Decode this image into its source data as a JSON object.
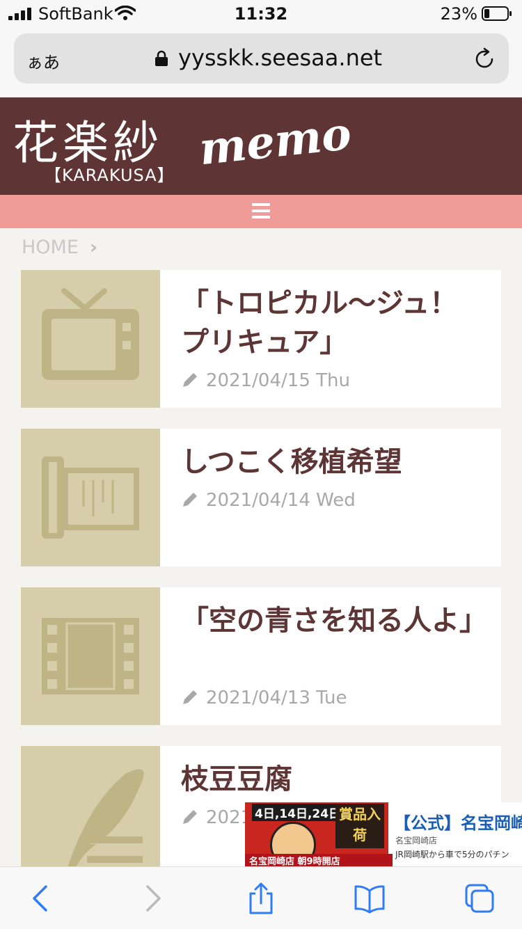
{
  "status": {
    "carrier": "SoftBank",
    "time": "11:32",
    "battery": "23%",
    "battery_level": 0.23
  },
  "browser": {
    "text_size_label": "ぁあ",
    "url": "yysskk.seesaa.net"
  },
  "site": {
    "logo_main": "花楽紗",
    "logo_memo": "memo",
    "logo_sub": "【KARAKUSA】"
  },
  "breadcrumb": {
    "home": "HOME",
    "separator": "›"
  },
  "posts": [
    {
      "title": "「トロピカル〜ジュ！プリキュア」",
      "date": "2021/04/15 Thu",
      "thumb_icon": "tv-icon"
    },
    {
      "title": "しつこく移植希望",
      "date": "2021/04/14 Wed",
      "thumb_icon": "scroll-icon"
    },
    {
      "title": "「空の青さを知る人よ」",
      "date": "2021/04/13 Tue",
      "thumb_icon": "film-icon"
    },
    {
      "title": "枝豆豆腐",
      "date": "2021",
      "thumb_icon": "quill-icon"
    }
  ],
  "ad": {
    "dates": "4日,14日,24日",
    "badge": "賞品入荷",
    "img_bottom": "名宝岡崎店 朝9時開店",
    "title": "【公式】名宝岡崎",
    "store": "名宝岡崎店",
    "desc": "JR岡崎駅から車で5分のパチン"
  },
  "colors": {
    "header_bg": "#5e3534",
    "nav_bg": "#ef9b97",
    "thumb_bg": "#d6ceab",
    "title": "#5c3534",
    "ad_link": "#1a5fb4"
  }
}
